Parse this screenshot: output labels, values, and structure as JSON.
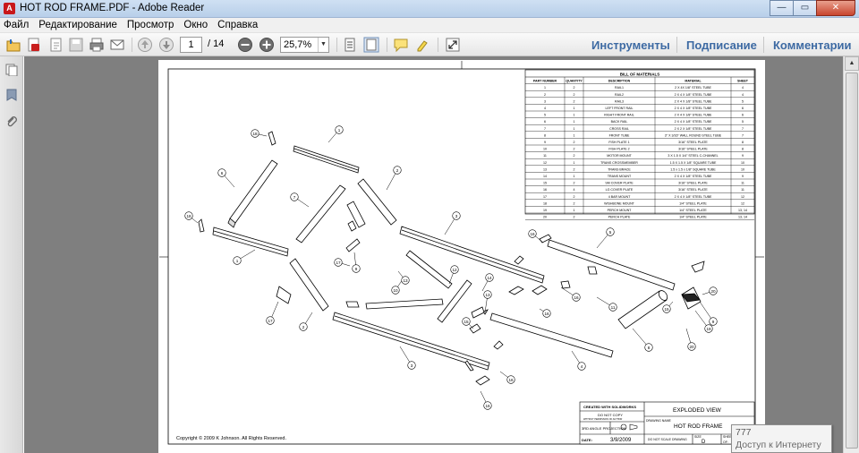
{
  "window": {
    "title": "HOT ROD FRAME.PDF - Adobe Reader",
    "minimize": "—",
    "maximize": "▭",
    "close": "✕"
  },
  "menu": [
    "Файл",
    "Редактирование",
    "Просмотр",
    "Окно",
    "Справка"
  ],
  "toolbar": {
    "page_current": "1",
    "page_total": "/ 14",
    "zoom": "25,7%",
    "links": [
      "Инструменты",
      "Подписание",
      "Комментарии"
    ]
  },
  "drawing": {
    "bom_title": "BILL OF MATERIALS",
    "bom_headers": [
      "PART NUMBER",
      "QUANTITY",
      "DESCRIPTION",
      "MATERIAL",
      "SHEET"
    ],
    "bom_rows": [
      [
        "1",
        "2",
        "RAIL1",
        "2 X 4X 1/8\" STEEL TUBE",
        "4"
      ],
      [
        "2",
        "2",
        "RAIL2",
        "2 X 4 X 1/8\" STEEL TUBE",
        "4"
      ],
      [
        "3",
        "2",
        "RAIL3",
        "2 X 4 X 1/8\" STEEL TUBE",
        "5"
      ],
      [
        "4",
        "1",
        "LEFT FRONT RAIL",
        "2 X 4 X 1/8\" STEEL TUBE",
        "6"
      ],
      [
        "5",
        "1",
        "RIGHT FRONT RAIL",
        "2 X 4 X 1/8\" STEEL TUBE",
        "6"
      ],
      [
        "6",
        "1",
        "BACK RAIL",
        "2 X 4 X 1/8\" STEEL TUBE",
        "5"
      ],
      [
        "7",
        "1",
        "CROSS RAIL",
        "2 X 2 X 1/8\" STEEL TUBE",
        "7"
      ],
      [
        "8",
        "1",
        "FRONT TUBE",
        "3\" X 3/16\" WALL ROUND STEEL TUBE",
        "7"
      ],
      [
        "9",
        "2",
        "FISH PLATE 1",
        "3/16\" STEEL PLATE",
        "8"
      ],
      [
        "10",
        "2",
        "FISH PLATE 2",
        "3/16\" STEEL PLATE",
        "8"
      ],
      [
        "11",
        "2",
        "MOTOR MOUNT",
        "3 X 1.5 X 1/4\" STEEL C-CHANNEL",
        "9"
      ],
      [
        "12",
        "1",
        "TRANS CROSSMEMBER",
        "1.5 X 1.5 X 1/8\" SQUARE TUBE",
        "10"
      ],
      [
        "13",
        "2",
        "TRANS BRACE",
        "1.5 x 1.5 x 1/8\" SQUARE TUBE",
        "10"
      ],
      [
        "14",
        "1",
        "TRANS MOUNT",
        "2 X 4 X 1/8\" STEEL TUBE",
        "9"
      ],
      [
        "15",
        "2",
        "SM COVER PLATE",
        "3/16\" STEEL PLATE",
        "11"
      ],
      [
        "16",
        "4",
        "LG COVER PLATE",
        "3/16\" STEEL PLATE",
        "11"
      ],
      [
        "17",
        "2",
        "4 BAR MOUNT",
        "2 X 4 X 1/8\" STEEL TUBE",
        "12"
      ],
      [
        "18",
        "2",
        "WISHBONE MOUNT",
        "1/4\" STEEL PLATE",
        "12"
      ],
      [
        "19",
        "1",
        "PERCH MOUNT",
        "1/4\" STEEL PLATE",
        "13, 14"
      ],
      [
        "20",
        "2",
        "PERCH PLATE",
        "1/4\" STEEL PLATE",
        "13, 14"
      ]
    ],
    "balloons": [
      "1",
      "1",
      "2",
      "2",
      "3",
      "3",
      "4",
      "5",
      "6",
      "7",
      "8",
      "9",
      "9",
      "10",
      "11",
      "12",
      "13",
      "13",
      "14",
      "15",
      "16",
      "16",
      "16",
      "16",
      "16",
      "17",
      "17",
      "18",
      "18",
      "19",
      "20",
      "20",
      "15"
    ],
    "title_block": {
      "created": "CREATED WITH SOLIDWORKS",
      "do_not_copy": "DO NOT COPY",
      "copy_sub": "WITHOUT PERMISSION OF AUTHOR",
      "projection": "3RD ANGLE PROJECTION",
      "date_label": "DATE:",
      "date": "3/9/2009",
      "do_not_scale": "DO NOT SCALE DRAWING",
      "view": "EXPLODED VIEW",
      "drawing_name_label": "DRAWING NAME",
      "drawing_name": "HOT ROD FRAME",
      "size_label": "SIZE",
      "size": "D",
      "sheet_label": "SHEET:",
      "sheet": "1",
      "of_label": "OF:",
      "of": "14",
      "rev_label": "REV.",
      "rev": "A"
    },
    "copyright": "Copyright © 2009 K Johnson. All Rights Reserved."
  },
  "tooltip": {
    "line1": "777",
    "line2": "Доступ к Интернету"
  }
}
